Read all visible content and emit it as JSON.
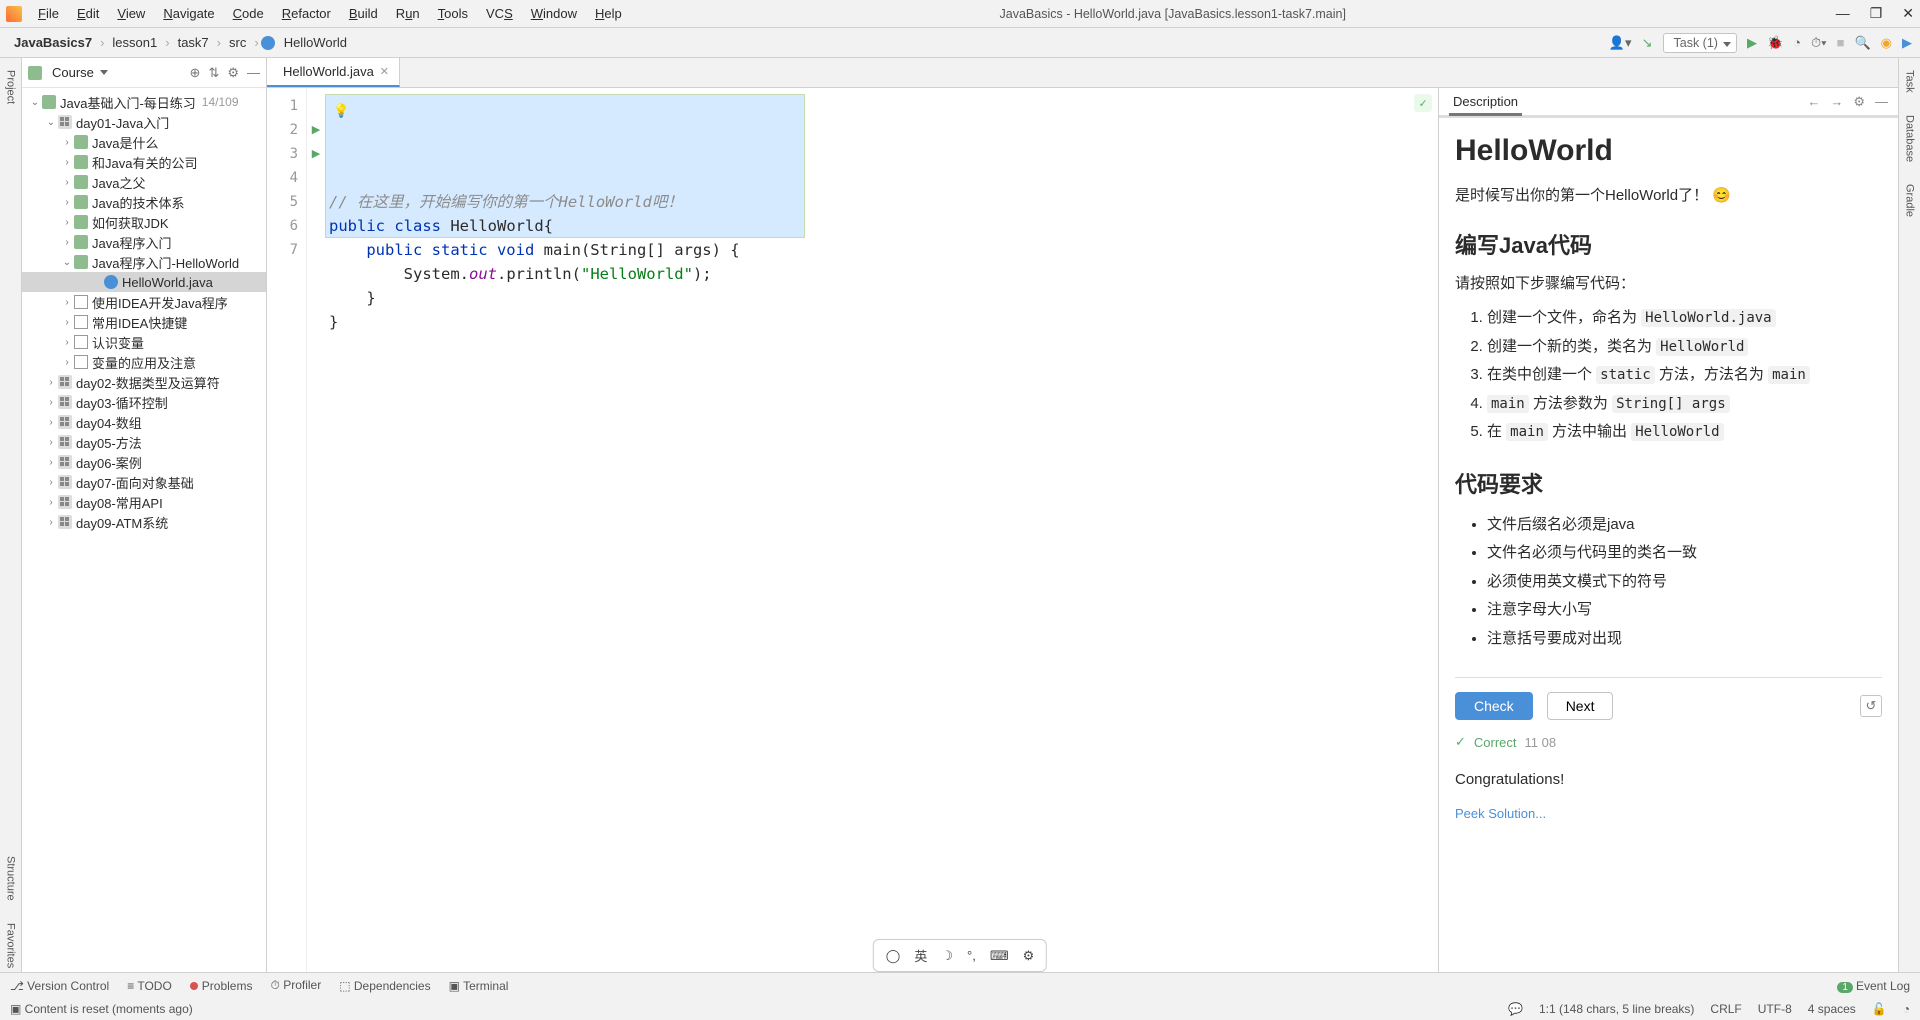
{
  "menu": {
    "file": "File",
    "edit": "Edit",
    "view": "View",
    "navigate": "Navigate",
    "code": "Code",
    "refactor": "Refactor",
    "build": "Build",
    "run": "Run",
    "tools": "Tools",
    "vcs": "VCS",
    "window": "Window",
    "help": "Help"
  },
  "title": "JavaBasics - HelloWorld.java [JavaBasics.lesson1-task7.main]",
  "breadcrumbs": [
    "JavaBasics7",
    "lesson1",
    "task7",
    "src",
    "HelloWorld"
  ],
  "toolbar": {
    "task": "Task (1)"
  },
  "sidebar": {
    "course_label": "Course",
    "root": {
      "label": "Java基础入门-每日练习",
      "count": "14/109"
    },
    "day01": {
      "label": "day01-Java入门",
      "children": [
        "Java是什么",
        "和Java有关的公司",
        "Java之父",
        "Java的技术体系",
        "如何获取JDK",
        "Java程序入门"
      ]
    },
    "hw_parent": "Java程序入门-HelloWorld",
    "hw_file": "HelloWorld.java",
    "after": [
      "使用IDEA开发Java程序",
      "常用IDEA快捷键",
      "认识变量",
      "变量的应用及注意"
    ],
    "days": [
      "day02-数据类型及运算符",
      "day03-循环控制",
      "day04-数组",
      "day05-方法",
      "day06-案例",
      "day07-面向对象基础",
      "day08-常用API",
      "day09-ATM系统"
    ]
  },
  "tab": {
    "name": "HelloWorld.java"
  },
  "code": {
    "lines": [
      "1",
      "2",
      "3",
      "4",
      "5",
      "6",
      "7"
    ],
    "l1_com": "// 在这里，开始编写你的第一个HelloWorld吧！",
    "l2_a": "public class ",
    "l2_b": "HelloWorld{",
    "l3_a": "    public static void ",
    "l3_m": "main",
    "l3_b": "(String[] args) {",
    "l4_a": "        System.",
    "l4_out": "out",
    "l4_b": ".println(",
    "l4_s": "\"HelloWorld\"",
    "l4_c": ");",
    "l5": "    }",
    "l6": "}"
  },
  "desc": {
    "tab": "Description",
    "h1": "HelloWorld",
    "intro": "是时候写出你的第一个HelloWorld了！ 😊",
    "h2a": "编写Java代码",
    "pa": "请按照如下步骤编写代码：",
    "ol": [
      {
        "t1": "创建一个文件，命名为 ",
        "c": "HelloWorld.java"
      },
      {
        "t1": "创建一个新的类，类名为 ",
        "c": "HelloWorld"
      },
      {
        "t1": "在类中创建一个 ",
        "c": "static",
        "t2": " 方法，方法名为 ",
        "c2": "main"
      },
      {
        "c": "main",
        "t2": " 方法参数为 ",
        "c2": "String[] args"
      },
      {
        "t1": "在 ",
        "c": "main",
        "t2": " 方法中输出 ",
        "c2": "HelloWorld"
      }
    ],
    "h2b": "代码要求",
    "ul": [
      "文件后缀名必须是java",
      "文件名必须与代码里的类名一致",
      "必须使用英文模式下的符号",
      "注意字母大小写",
      "注意括号要成对出现"
    ],
    "check": "Check",
    "next": "Next",
    "correct": "Correct",
    "correct_ts": "11 08",
    "congrats": "Congratulations!",
    "peek": "Peek Solution..."
  },
  "bottom": {
    "vc": "Version Control",
    "todo": "TODO",
    "problems": "Problems",
    "profiler": "Profiler",
    "deps": "Dependencies",
    "terminal": "Terminal",
    "eventlog": "Event Log"
  },
  "status": {
    "msg": "Content is reset (moments ago)",
    "pos": "1:1 (148 chars, 5 line breaks)",
    "eol": "CRLF",
    "enc": "UTF-8",
    "indent": "4 spaces"
  },
  "left_gutter": [
    "Project",
    "Structure",
    "Favorites"
  ],
  "right_gutter": [
    "Task",
    "Database",
    "Gradle"
  ],
  "ime": {
    "lang": "英"
  }
}
